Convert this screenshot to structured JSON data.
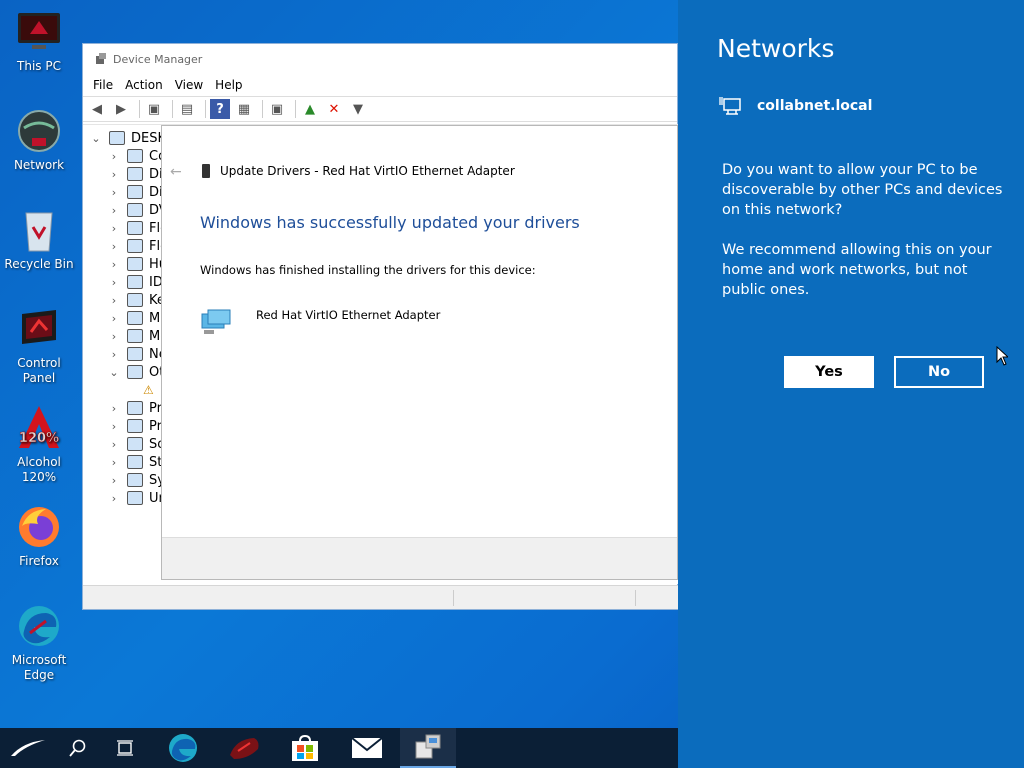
{
  "desktop": {
    "icons": [
      {
        "label": "This PC",
        "icon": "computer-icon"
      },
      {
        "label": "Network",
        "icon": "network-globe-icon"
      },
      {
        "label": "Recycle Bin",
        "icon": "recycle-bin-icon"
      },
      {
        "label": "Control\nPanel",
        "icon": "control-panel-icon"
      },
      {
        "label": "Alcohol\n120%",
        "icon": "alcohol-120-icon"
      },
      {
        "label": "Firefox",
        "icon": "firefox-icon"
      },
      {
        "label": "Microsoft\nEdge",
        "icon": "edge-icon"
      }
    ]
  },
  "device_manager": {
    "title": "Device Manager",
    "menu": [
      "File",
      "Action",
      "View",
      "Help"
    ],
    "tree": {
      "root": "DESK",
      "items": [
        "Co",
        "Dis",
        "Dis",
        "DV",
        "Flo",
        "Flo",
        "Hu",
        "IDE",
        "Ke",
        "Mic",
        "Mo",
        "Ne",
        "Oth",
        "",
        "Pri",
        "Pro",
        "So",
        "Sto",
        "Sy",
        "Un"
      ]
    }
  },
  "update_drivers": {
    "title": "Update Drivers - Red Hat VirtIO Ethernet Adapter",
    "heading": "Windows has successfully updated your drivers",
    "message": "Windows has finished installing the drivers for this device:",
    "device_name": "Red Hat VirtIO Ethernet Adapter"
  },
  "networks": {
    "title": "Networks",
    "network_name": "collabnet.local",
    "question": "Do you want to allow your PC to be discoverable by other PCs and devices on this network?",
    "recommendation": "We recommend allowing this on your home and work networks, but not public ones.",
    "yes_label": "Yes",
    "no_label": "No"
  },
  "colors": {
    "network_pane": "#0b6cbd",
    "heading_blue": "#1e4e99",
    "taskbar": "#0b1f36"
  },
  "taskbar": {
    "items": [
      "start-icon",
      "search-icon",
      "task-view-icon",
      "edge-icon",
      "rog-icon",
      "store-icon",
      "mail-icon",
      "device-manager-icon"
    ]
  }
}
